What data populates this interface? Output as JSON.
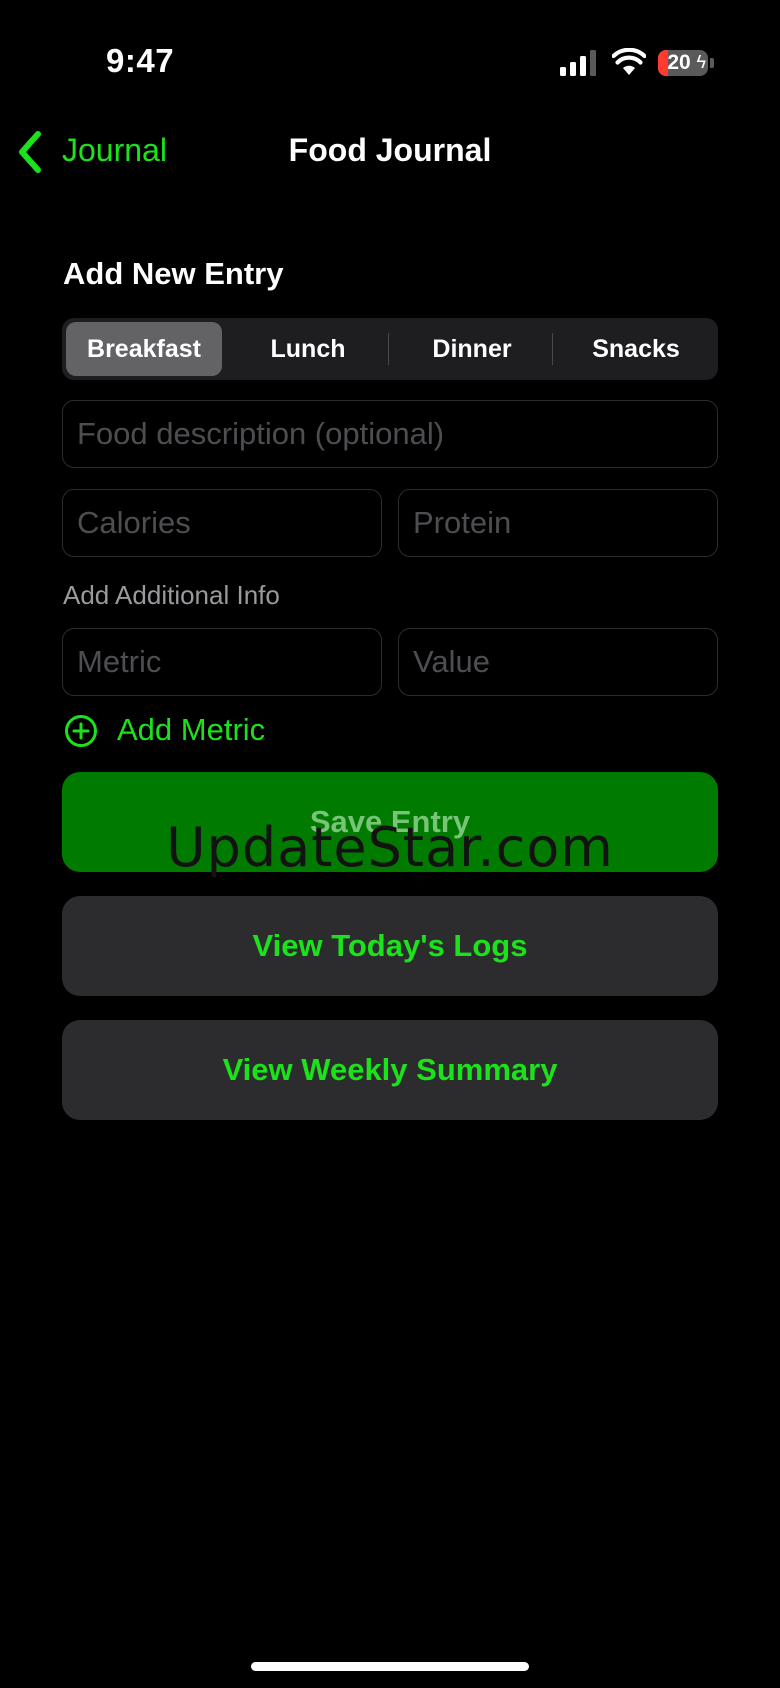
{
  "status_bar": {
    "time": "9:47",
    "signal_icon": "cellular-signal-icon",
    "wifi_icon": "wifi-icon",
    "battery_level": "20",
    "battery_charging": true
  },
  "nav": {
    "back_label": "Journal",
    "title": "Food Journal"
  },
  "form": {
    "heading": "Add New Entry",
    "meal_types": [
      "Breakfast",
      "Lunch",
      "Dinner",
      "Snacks"
    ],
    "selected_meal": "Breakfast",
    "food_description_placeholder": "Food description (optional)",
    "calories_placeholder": "Calories",
    "protein_placeholder": "Protein",
    "additional_info_label": "Add Additional Info",
    "metric_placeholder": "Metric",
    "value_placeholder": "Value",
    "add_metric_label": "Add Metric"
  },
  "actions": {
    "save_label": "Save Entry",
    "todays_logs_label": "View Today's Logs",
    "weekly_summary_label": "View Weekly Summary"
  },
  "watermark": "UpdateStar.com",
  "colors": {
    "accent": "#1be21b",
    "save_button": "#007b00",
    "secondary_button": "#2c2c2e",
    "background": "#000000"
  }
}
